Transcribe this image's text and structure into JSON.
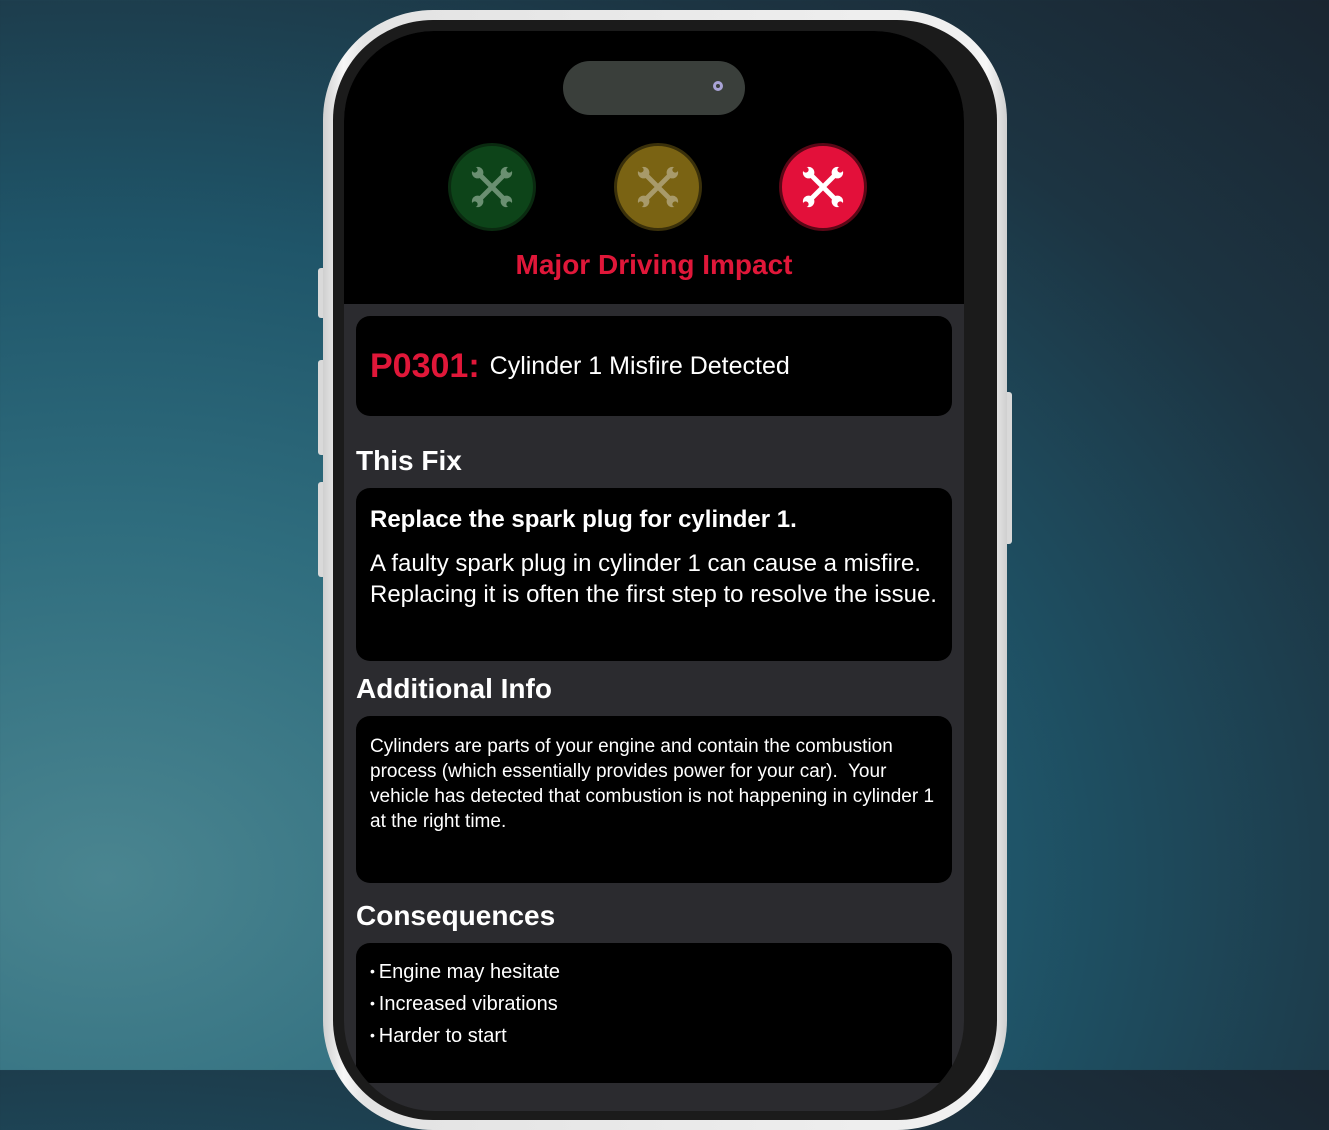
{
  "impact": {
    "label": "Major Driving Impact",
    "active_level": "red",
    "levels": [
      {
        "color": "green",
        "icon": "wrench-icon"
      },
      {
        "color": "yellow",
        "icon": "wrench-icon"
      },
      {
        "color": "red",
        "icon": "wrench-icon"
      }
    ]
  },
  "code_card": {
    "code": "P0301:",
    "title": "Cylinder 1 Misfire Detected"
  },
  "this_fix": {
    "section_title": "This Fix",
    "headline": "Replace the spark plug for cylinder 1.",
    "body": "A faulty spark plug in cylinder 1 can cause a misfire. Replacing it is often the first step to resolve the issue."
  },
  "additional_info": {
    "section_title": "Additional Info",
    "body": "Cylinders are parts of your engine and contain the combustion process (which essentially provides power for your car).  Your vehicle has detected that combustion is not happening in cylinder 1 at the right time."
  },
  "consequences": {
    "section_title": "Consequences",
    "items": [
      "Engine may hesitate",
      "Increased vibrations",
      "Harder to start"
    ]
  },
  "colors": {
    "accent_red": "#e01739",
    "green_light": "#0d4419",
    "yellow_light": "#7a6313",
    "red_light": "#e3103a"
  }
}
